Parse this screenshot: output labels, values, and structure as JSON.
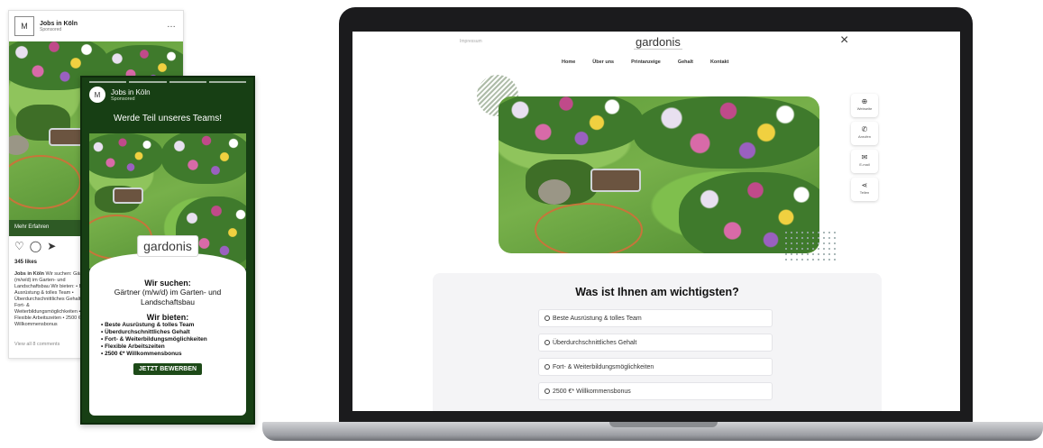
{
  "phone_feed": {
    "brand_initials": "M",
    "account_name": "Jobs in Köln",
    "sponsored": "Sponsored",
    "more_icon": "…",
    "cta": "Mehr Erfahren",
    "icons": [
      "heart-icon",
      "comment-icon",
      "share-icon"
    ],
    "likes": "345 likes",
    "caption_name": "Jobs in Köln",
    "caption_text": "Wir suchen: Gärtner (m/w/d) im Garten- und Landschaftsbau Wir bieten: • Beste Ausrüstung & tolles Team • Überdurchschnittliches Gehalt • Fort- & Weiterbildungsmöglichkeiten • Flexible Arbeitszeiten • 2500 €* Willkommensbonus",
    "view_comments": "View all 8 comments"
  },
  "phone_story": {
    "account_name": "Jobs in Köln",
    "sponsored": "Sponsored",
    "headline": "Werde Teil unseres Teams!",
    "brand": "gardonis",
    "seek_heading": "Wir suchen:",
    "seek_text": "Gärtner (m/w/d) im Garten- und Landschaftsbau",
    "offer_heading": "Wir bieten:",
    "offers": [
      "• Beste Ausrüstung & tolles Team",
      "• Überdurchschnittliches Gehalt",
      "• Fort- & Weiterbildungsmöglichkeiten",
      "• Flexible Arbeitszeiten",
      "• 2500 €* Willkommensbonus"
    ],
    "apply_button": "JETZT BEWERBEN"
  },
  "laptop": {
    "top_left": "Impressum",
    "brand": "gardonis",
    "close_icon": "×",
    "nav": [
      "Home",
      "Über uns",
      "Printanzeige",
      "Gehalt",
      "Kontakt"
    ],
    "side_buttons": [
      {
        "icon": "globe-icon",
        "glyph": "⊕",
        "label": "Webseite"
      },
      {
        "icon": "phone-icon",
        "glyph": "✆",
        "label": "Anrufen"
      },
      {
        "icon": "mail-icon",
        "glyph": "✉",
        "label": "E-mail"
      },
      {
        "icon": "share-icon",
        "glyph": "⋖",
        "label": "Teilen"
      }
    ],
    "quiz_title": "Was ist Ihnen am wichtigsten?",
    "options": [
      "Beste Ausrüstung & tolles Team",
      "Überdurchschnittliches Gehalt",
      "Fort- & Weiterbildungsmöglichkeiten",
      "2500 €* Willkommensbonus"
    ]
  },
  "colors": {
    "story_green": "#173f14",
    "button_green": "#1d4a18",
    "laptop_frame": "#1b1b1d"
  }
}
